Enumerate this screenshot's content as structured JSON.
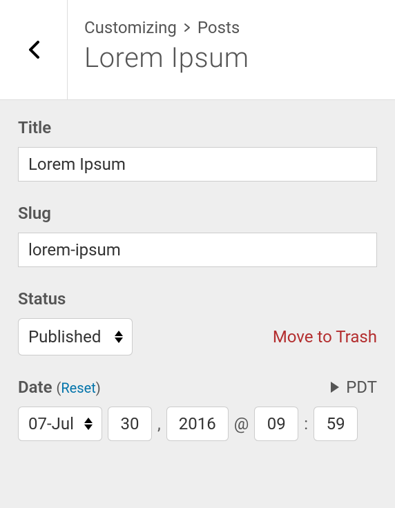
{
  "header": {
    "breadcrumb_root": "Customizing",
    "breadcrumb_section": "Posts",
    "page_title": "Lorem Ipsum"
  },
  "fields": {
    "title": {
      "label": "Title",
      "value": "Lorem Ipsum"
    },
    "slug": {
      "label": "Slug",
      "value": "lorem-ipsum"
    },
    "status": {
      "label": "Status",
      "value": "Published",
      "trash_label": "Move to Trash"
    },
    "date": {
      "label": "Date",
      "reset_label": "Reset",
      "timezone": "PDT",
      "month": "07-Jul",
      "day": "30",
      "year": "2016",
      "hour": "09",
      "minute": "59",
      "sep_comma": ",",
      "sep_at": "@",
      "sep_colon": ":",
      "paren_open": "(",
      "paren_close": ")"
    }
  }
}
